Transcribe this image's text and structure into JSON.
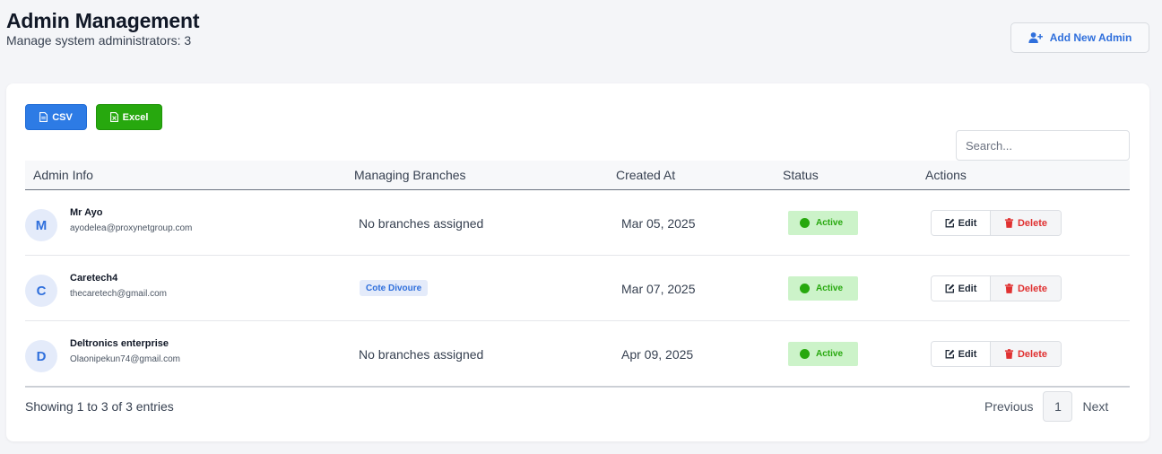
{
  "header": {
    "title": "Admin Management",
    "subtitle": "Manage system administrators: 3",
    "add_button_label": "Add New Admin"
  },
  "toolbar": {
    "csv_label": "CSV",
    "excel_label": "Excel",
    "search_placeholder": "Search..."
  },
  "table": {
    "columns": [
      "Admin Info",
      "Managing Branches",
      "Created At",
      "Status",
      "Actions"
    ],
    "rows": [
      {
        "initial": "M",
        "name": "Mr Ayo",
        "email": "ayodelea@proxynetgroup.com",
        "branch": "No branches assigned",
        "created": "Mar 05, 2025",
        "status": "Active"
      },
      {
        "initial": "C",
        "name": "Caretech4",
        "email": "thecaretech@gmail.com",
        "branch": "Cote Divoure",
        "created": "Mar 07, 2025",
        "status": "Active"
      },
      {
        "initial": "D",
        "name": "Deltronics enterprise",
        "email": "Olaonipekun74@gmail.com",
        "branch": "No branches assigned",
        "created": "Apr 09, 2025",
        "status": "Active"
      }
    ],
    "edit_label": "Edit",
    "delete_label": "Delete"
  },
  "pagination": {
    "info": "Showing 1 to 3 of 3 entries",
    "previous": "Previous",
    "current": "1",
    "next": "Next"
  },
  "colors": {
    "primary": "#2d7be5",
    "success": "#27a80e",
    "danger": "#e03131",
    "background": "#f4f5f8"
  }
}
